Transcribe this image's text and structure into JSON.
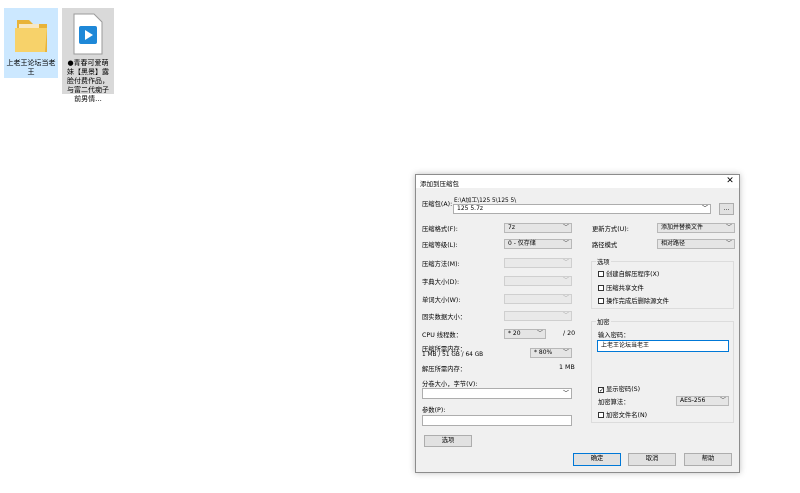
{
  "desktop": {
    "icons": [
      {
        "label": "上老王论坛当老王"
      },
      {
        "label": "●青春可爱萌妹【黑景】露脸付费作品，与富二代痴子前男情..."
      }
    ]
  },
  "dialog": {
    "title": "添加到压缩包",
    "archive_label": "压缩包(A):",
    "path_hint": "E:\\A加工\\125 5\\125 5\\",
    "archive_value": "125 5.7z",
    "browse_label": "...",
    "left": {
      "format_label": "压缩格式(F):",
      "format_value": "7z",
      "level_label": "压缩等级(L):",
      "level_value": "0 - 仅存储",
      "method_label": "压缩方法(M):",
      "dict_label": "字典大小(D):",
      "word_label": "单词大小(W):",
      "solid_label": "固实数据大小：",
      "cpu_label": "CPU 线程数：",
      "cpu_value": "* 20",
      "cpu_total": "/ 20",
      "mem_label": "压缩所需内存：",
      "mem_detail": "1 MB / 51 GB / 64 GB",
      "mem_value": "* 80%",
      "decomp_label": "解压所需内存：",
      "decomp_value": "1 MB",
      "split_label": "分卷大小，字节(V):",
      "params_label": "参数(P):",
      "options_button": "选项"
    },
    "right": {
      "update_label": "更新方式(U):",
      "update_value": "添加并替换文件",
      "path_label": "路径模式",
      "path_value": "相对路径",
      "options_group": "选项",
      "opt_sfx": "创建自解压程序(X)",
      "opt_shared": "压缩共享文件",
      "opt_delete": "操作完成后删除源文件",
      "encrypt_group": "加密",
      "password_label": "输入密码：",
      "password_value": "上老王论坛当老王",
      "show_password": "显示密码(S)",
      "enc_method_label": "加密算法：",
      "enc_method_value": "AES-256",
      "encrypt_names": "加密文件名(N)"
    },
    "buttons": {
      "ok": "确定",
      "cancel": "取消",
      "help": "帮助"
    }
  }
}
